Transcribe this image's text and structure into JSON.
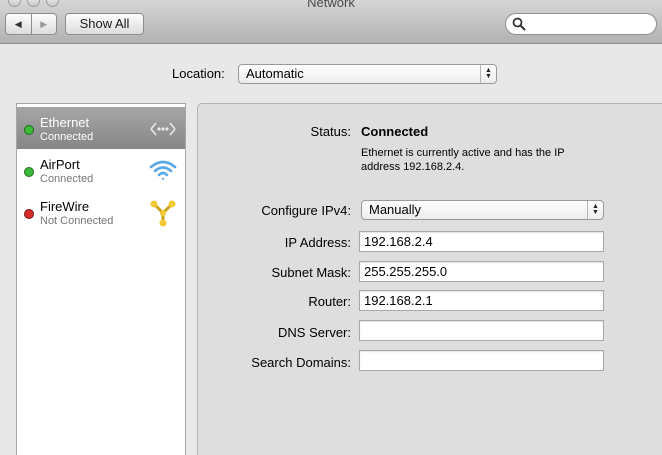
{
  "window": {
    "title": "Network"
  },
  "toolbar": {
    "back_icon": "back-arrow-icon",
    "forward_icon": "forward-arrow-icon",
    "show_all_label": "Show All",
    "search_icon": "magnifier-icon",
    "search_value": ""
  },
  "location": {
    "label": "Location:",
    "value": "Automatic"
  },
  "services": [
    {
      "name": "Ethernet",
      "status": "Connected",
      "status_color": "#3db83a",
      "icon": "ethernet-icon",
      "selected": true
    },
    {
      "name": "AirPort",
      "status": "Connected",
      "status_color": "#3db83a",
      "icon": "wifi-icon",
      "selected": false
    },
    {
      "name": "FireWire",
      "status": "Not Connected",
      "status_color": "#d62b2b",
      "icon": "firewire-icon",
      "selected": false
    }
  ],
  "detail": {
    "status_label": "Status:",
    "status_value": "Connected",
    "status_description_line1": "Ethernet is currently active and has the IP",
    "status_description_line2": "address 192.168.2.4.",
    "configure_label": "Configure IPv4:",
    "configure_value": "Manually",
    "ip_label": "IP Address:",
    "ip_value": "192.168.2.4",
    "subnet_label": "Subnet Mask:",
    "subnet_value": "255.255.255.0",
    "router_label": "Router:",
    "router_value": "192.168.2.1",
    "dns_label": "DNS Server:",
    "dns_value": "",
    "search_domains_label": "Search Domains:",
    "search_domains_value": ""
  },
  "colors": {
    "selected_row": "#949494",
    "connected": "#3db83a",
    "not_connected": "#d62b2b"
  }
}
